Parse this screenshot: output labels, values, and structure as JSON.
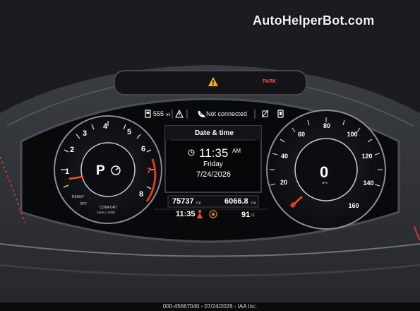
{
  "watermark": "AutoHelperBot.com",
  "footer": "000-45667040 - 07/24/2026 - IAA Inc.",
  "indicators": {
    "park": "PARK"
  },
  "status_bar": {
    "range_value": "555",
    "range_unit": "mi",
    "connection": "Not connected"
  },
  "center_panel": {
    "title": "Date & time",
    "time": "11:35",
    "ampm": "AM",
    "day": "Friday",
    "date": "7/24/2026"
  },
  "odometer": {
    "total": "75737",
    "total_unit": "mi",
    "trip": "6066.8",
    "trip_unit": "mi"
  },
  "bottom_bar": {
    "time": "11:35",
    "temperature": "91",
    "temp_unit": "°F"
  },
  "tachometer": {
    "ticks": [
      "1",
      "2",
      "3",
      "4",
      "5",
      "6",
      "7",
      "8"
    ],
    "gear": "P",
    "ready": "READY",
    "off": "OFF",
    "mode": "COMFORT",
    "unit": "1/min x 1000"
  },
  "speedometer": {
    "ticks": [
      "20",
      "40",
      "60",
      "80",
      "100",
      "120",
      "140",
      "160"
    ],
    "speed": "0",
    "unit": "MPH"
  },
  "colors": {
    "warning": "#f5b400",
    "park": "#ff4a5a",
    "needle": "#ff4a2a",
    "accent_orange": "#ff7a1a"
  }
}
